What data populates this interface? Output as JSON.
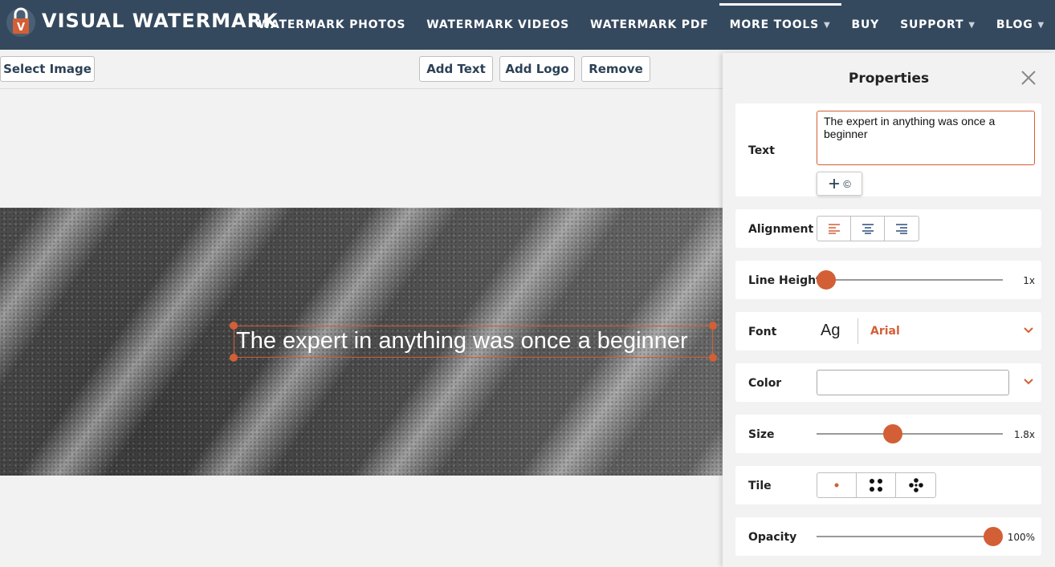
{
  "header": {
    "brand": "VISUAL WATERMARK",
    "logo_letter": "V",
    "nav": [
      {
        "label": "WATERMARK PHOTOS"
      },
      {
        "label": "WATERMARK VIDEOS"
      },
      {
        "label": "WATERMARK PDF"
      },
      {
        "label": "MORE TOOLS",
        "caret": "▼"
      },
      {
        "label": "BUY"
      },
      {
        "label": "SUPPORT",
        "caret": "▼"
      },
      {
        "label": "BLOG",
        "caret": "▼"
      }
    ]
  },
  "toolbar": {
    "select_image": "Select Image",
    "add_text": "Add Text",
    "add_logo": "Add Logo",
    "remove": "Remove"
  },
  "canvas": {
    "watermark_text": "The expert in anything was once a beginner"
  },
  "properties": {
    "title": "Properties",
    "text_label": "Text",
    "text_value": "The expert in anything was once a beginner",
    "copyright_symbol": "©",
    "alignment_label": "Alignment",
    "alignment_selected": "left",
    "line_height_label": "Line Height",
    "line_height_value": "1x",
    "line_height_fraction": 0.0,
    "font_label": "Font",
    "font_preview": "Ag",
    "font_name": "Arial",
    "color_label": "Color",
    "color_value": "#ffffff",
    "size_label": "Size",
    "size_value": "1.8x",
    "size_fraction": 0.41,
    "tile_label": "Tile",
    "tile_selected": "single",
    "opacity_label": "Opacity",
    "opacity_value": "100%",
    "opacity_fraction": 1.0
  },
  "colors": {
    "header_bg": "#34495e",
    "accent": "#d35f36",
    "button_text": "#2c4156"
  }
}
